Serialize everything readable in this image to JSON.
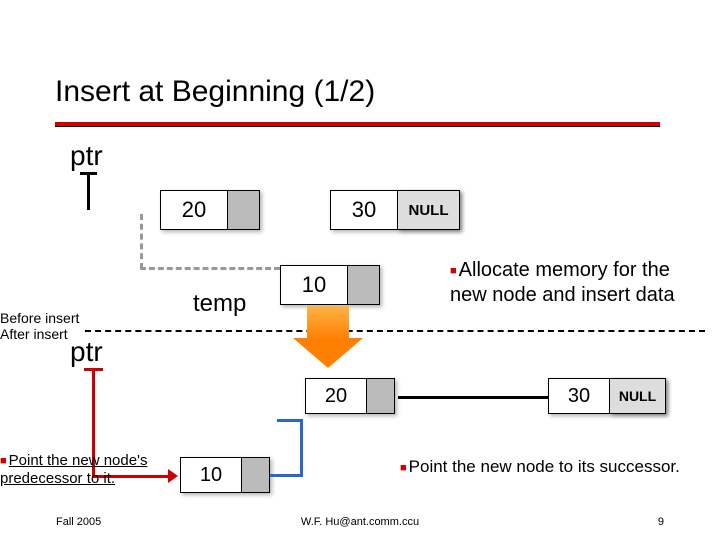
{
  "title": "Insert at Beginning (1/2)",
  "before": {
    "ptr_label": "ptr",
    "node1": "20",
    "node2": "30",
    "null_text": "NULL",
    "temp_label": "temp",
    "temp_node": "10"
  },
  "after": {
    "ptr_label": "ptr",
    "node_new": "10",
    "node1": "20",
    "node2": "30",
    "null_text": "NULL"
  },
  "labels": {
    "before_insert": "Before insert",
    "after_insert": "After insert"
  },
  "notes": {
    "allocate": "Allocate memory for the new node and insert data",
    "predecessor": "Point the new node's predecessor to it.",
    "successor": "Point the new node to its successor."
  },
  "footer": {
    "left": "Fall 2005",
    "center": "W.F. Hu@ant.comm.ccu",
    "page": "9"
  },
  "chart_data": {
    "type": "table",
    "title": "Linked list insert at beginning",
    "before_list": [
      20,
      30
    ],
    "insert_value": 10,
    "after_list": [
      10,
      20,
      30
    ],
    "pointers": {
      "ptr_before": 20,
      "temp": 10,
      "ptr_after": 10
    }
  }
}
